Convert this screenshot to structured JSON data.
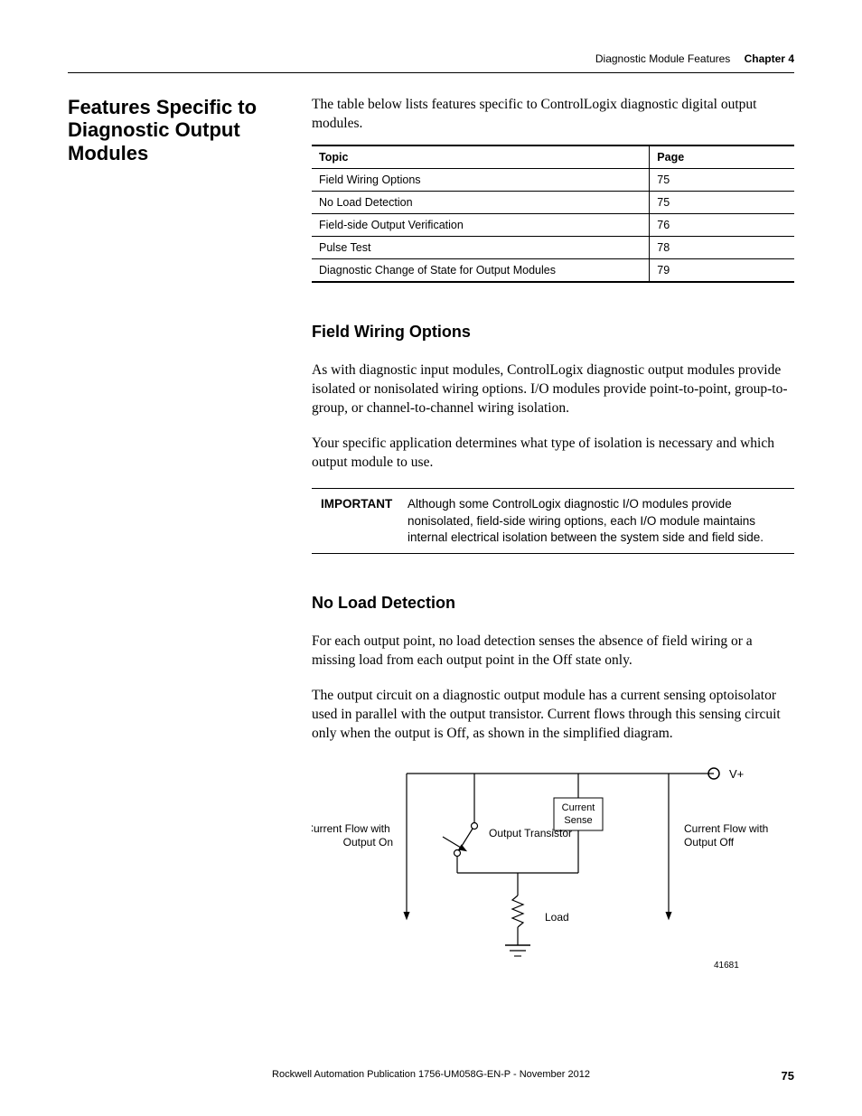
{
  "running_head": {
    "title": "Diagnostic Module Features",
    "chapter": "Chapter 4"
  },
  "section_heading": "Features Specific to Diagnostic Output Modules",
  "intro": "The table below lists features specific to ControlLogix diagnostic digital output modules.",
  "topic_table": {
    "head_topic": "Topic",
    "head_page": "Page",
    "rows": [
      {
        "topic": "Field Wiring Options",
        "page": "75"
      },
      {
        "topic": "No Load Detection",
        "page": "75"
      },
      {
        "topic": "Field-side Output Verification",
        "page": "76"
      },
      {
        "topic": "Pulse Test",
        "page": "78"
      },
      {
        "topic": "Diagnostic Change of State for Output Modules",
        "page": "79"
      }
    ]
  },
  "fwo": {
    "heading": "Field Wiring Options",
    "p1": "As with diagnostic input modules, ControlLogix diagnostic output modules provide isolated or nonisolated wiring options. I/O modules provide point-to-point, group-to-group, or channel-to-channel wiring isolation.",
    "p2": "Your specific application determines what type of isolation is necessary and which output module to use.",
    "important_label": "IMPORTANT",
    "important_text": "Although some ControlLogix diagnostic I/O modules provide nonisolated, field-side wiring options, each I/O module maintains internal electrical isolation between the system side and field side."
  },
  "nld": {
    "heading": "No Load Detection",
    "p1": "For each output point, no load detection senses the absence of field wiring or a missing load from each output point in the Off state only.",
    "p2": "The output circuit on a diagnostic output module has a current sensing optoisolator used in parallel with the output transistor. Current flows through this sensing circuit only when the output is Off, as shown in the simplified diagram."
  },
  "diagram": {
    "label_left": "Current Flow with Output On",
    "label_output_trans": "Output Transistor",
    "label_current_sense_1": "Current",
    "label_current_sense_2": "Sense",
    "label_load": "Load",
    "label_right": "Current Flow with Output Off",
    "label_vplus": "V+",
    "fig_id": "41681"
  },
  "footer_text": "Rockwell Automation Publication 1756-UM058G-EN-P - November 2012",
  "page_number": "75"
}
